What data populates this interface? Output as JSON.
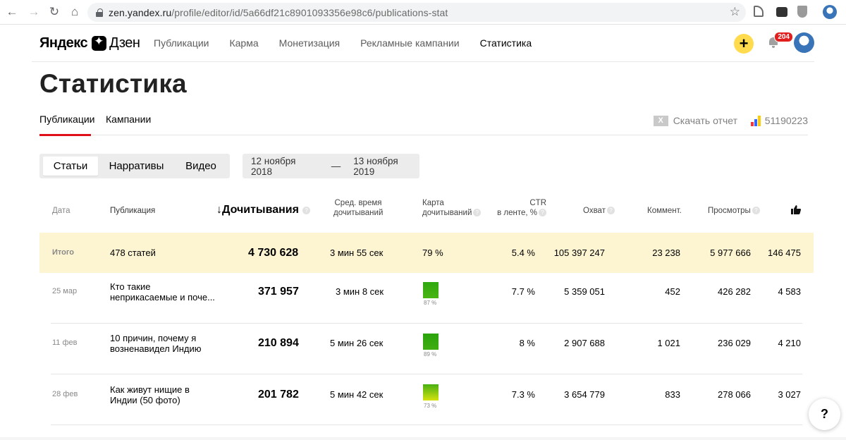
{
  "browser": {
    "url_host": "zen.yandex.ru",
    "url_path": "/profile/editor/id/5a66df21c8901093356e98c6/publications-stat"
  },
  "header": {
    "logo_left": "Яндекс",
    "logo_right": "Дзен",
    "nav": [
      "Публикации",
      "Карма",
      "Монетизация",
      "Рекламные кампании",
      "Статистика"
    ],
    "notifications_count": "204"
  },
  "page": {
    "title": "Статистика",
    "tabs": [
      "Публикации",
      "Кампании"
    ],
    "download_report": "Скачать отчет",
    "xls_icon_text": "X",
    "counter_id": "51190223",
    "content_types": [
      "Статьи",
      "Нарративы",
      "Видео"
    ],
    "date_from": "12 ноября 2018",
    "date_sep": "—",
    "date_to": "13 ноября 2019"
  },
  "table": {
    "headers": {
      "date": "Дата",
      "publication": "Публикация",
      "read_through": "↓Дочитывания",
      "avg_time": [
        "Сред. время",
        "дочитываний"
      ],
      "heatmap": [
        "Карта",
        "дочитываний"
      ],
      "ctr": [
        "CTR",
        "в ленте, %"
      ],
      "reach": "Охват",
      "comments": "Коммент.",
      "views": "Просмотры",
      "help_glyph": "?"
    },
    "total": {
      "label": "Итого",
      "publication": "478 статей",
      "read_through": "4 730 628",
      "avg_time": "3 мин 55 сек",
      "heatmap": "79 %",
      "ctr": "5.4 %",
      "reach": "105 397 247",
      "comments": "23 238",
      "views": "5 977 666",
      "likes": "146 475"
    },
    "rows": [
      {
        "date": "25 мар",
        "title_line1": "Кто такие",
        "title_line2": "неприкасаемые и поче...",
        "read_through": "371 957",
        "avg_time": "3 мин 8 сек",
        "heatmap_pct": "87 %",
        "ctr": "7.7 %",
        "reach": "5 359 051",
        "comments": "452",
        "views": "426 282",
        "likes": "4 583"
      },
      {
        "date": "11 фев",
        "title_line1": "10 причин, почему я",
        "title_line2": "возненавидел Индию",
        "read_through": "210 894",
        "avg_time": "5 мин 26 сек",
        "heatmap_pct": "89 %",
        "ctr": "8 %",
        "reach": "2 907 688",
        "comments": "1 021",
        "views": "236 029",
        "likes": "4 210"
      },
      {
        "date": "28 фев",
        "title_line1": "Как живут нищие в",
        "title_line2": "Индии (50 фото)",
        "read_through": "201 782",
        "avg_time": "5 мин 42 сек",
        "heatmap_pct": "73 %",
        "ctr": "7.3 %",
        "reach": "3 654 779",
        "comments": "833",
        "views": "278 066",
        "likes": "3 027"
      }
    ]
  },
  "help_button": "?",
  "colors": {
    "accent_red": "#e0101a",
    "plus_yellow": "#ffdb4d",
    "total_row_bg": "#fdf5d2",
    "badge_red": "#e21f1f"
  },
  "icons": [
    "back-icon",
    "forward-icon",
    "reload-icon",
    "home-icon",
    "lock-icon",
    "star-icon",
    "excel-icon",
    "metrika-icon",
    "like-icon",
    "bell-icon",
    "plus-icon",
    "help-icon"
  ]
}
